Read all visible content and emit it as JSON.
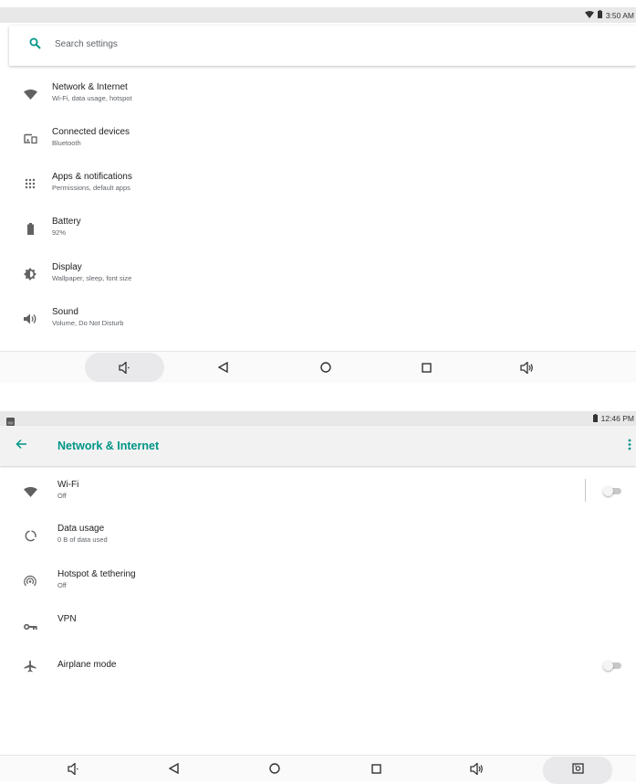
{
  "top_screen": {
    "status_time": "3:50 AM",
    "search_placeholder": "Search settings",
    "items": [
      {
        "title": "Network & Internet",
        "subtitle": "Wi-Fi, data usage, hotspot",
        "icon": "wifi-icon"
      },
      {
        "title": "Connected devices",
        "subtitle": "Bluetooth",
        "icon": "devices-icon"
      },
      {
        "title": "Apps & notifications",
        "subtitle": "Permissions, default apps",
        "icon": "apps-icon"
      },
      {
        "title": "Battery",
        "subtitle": "92%",
        "icon": "battery-icon"
      },
      {
        "title": "Display",
        "subtitle": "Wallpaper, sleep, font size",
        "icon": "brightness-icon"
      },
      {
        "title": "Sound",
        "subtitle": "Volume, Do Not Disturb",
        "icon": "volume-icon"
      }
    ]
  },
  "bottom_screen": {
    "status_time": "12:46 PM",
    "title": "Network & Internet",
    "items": [
      {
        "title": "Wi-Fi",
        "subtitle": "Off",
        "icon": "wifi-icon",
        "toggle": "off"
      },
      {
        "title": "Data usage",
        "subtitle": "0 B of data used",
        "icon": "data-usage-icon"
      },
      {
        "title": "Hotspot & tethering",
        "subtitle": "Off",
        "icon": "hotspot-icon"
      },
      {
        "title": "VPN",
        "subtitle": "",
        "icon": "vpn-key-icon"
      },
      {
        "title": "Airplane mode",
        "subtitle": "",
        "icon": "airplane-icon",
        "toggle": "off"
      }
    ]
  },
  "colors": {
    "accent": "#009688",
    "status_bar": "#e8e8e8"
  }
}
